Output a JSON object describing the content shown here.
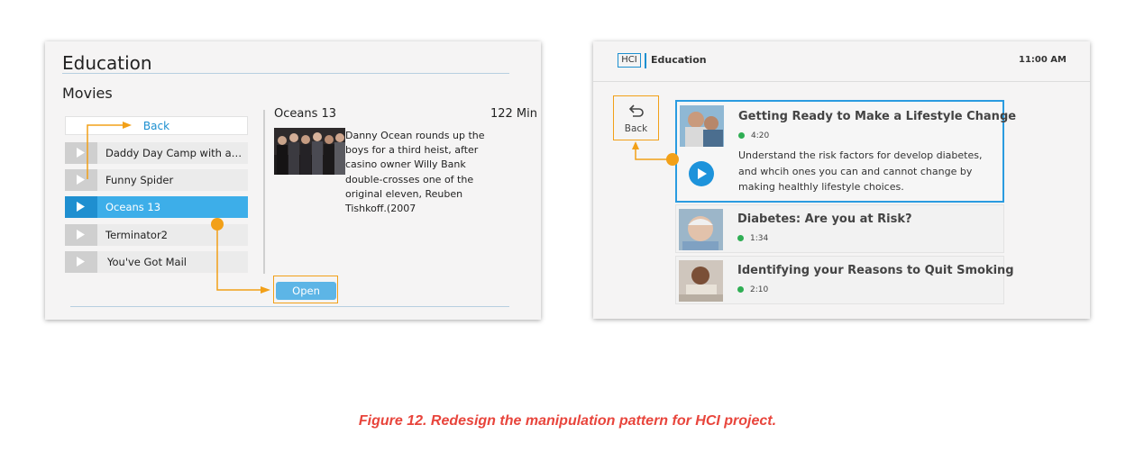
{
  "left": {
    "title": "Education",
    "subtitle": "Movies",
    "back_label": "Back",
    "movies": [
      {
        "label": "Daddy Day Camp with an..."
      },
      {
        "label": "Funny Spider"
      },
      {
        "label": "Oceans 13",
        "selected": true
      },
      {
        "label": "Terminator2"
      },
      {
        "label": "You've Got Mail"
      }
    ],
    "detail": {
      "title": "Oceans 13",
      "duration": "122 Min",
      "description": "Danny Ocean rounds up the boys for a third heist, after casino owner Willy Bank double-crosses one of the original eleven, Reuben Tishkoff.(2007"
    },
    "open_label": "Open"
  },
  "right": {
    "logo": "HCI",
    "app_title": "Education",
    "time": "11:00 AM",
    "back_label": "Back",
    "cards": [
      {
        "title": "Getting Ready to Make a Lifestyle Change",
        "duration": "4:20",
        "description": "Understand the risk factors for develop diabetes, and whcih ones you can and cannot change by making healthly lifestyle choices."
      },
      {
        "title": "Diabetes: Are you at Risk?",
        "duration": "1:34"
      },
      {
        "title": "Identifying your Reasons to Quit Smoking",
        "duration": "2:10"
      }
    ]
  },
  "colors": {
    "accent_blue": "#1c8fd0",
    "selection_blue": "#3daee9",
    "annotation_orange": "#f2a018",
    "caption_red": "#e8453c",
    "duration_green": "#2fae54"
  },
  "caption": "Figure 12. Redesign the manipulation pattern for HCI project."
}
